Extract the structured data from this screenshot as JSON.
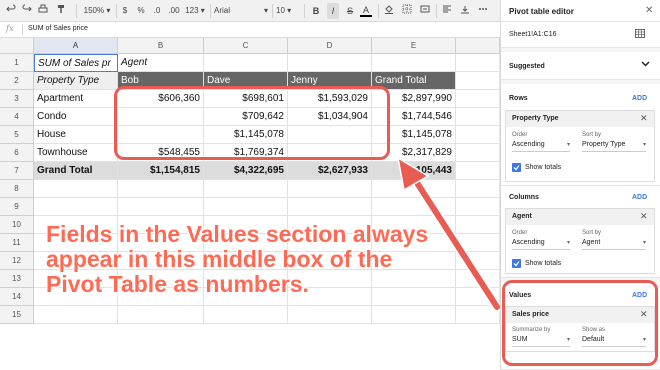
{
  "toolbar": {
    "zoom": "150%",
    "currency": "$",
    "percent": "%",
    "decimal_less": ".0",
    "decimal_more": ".00",
    "number_format": "123",
    "font_family": "Arial",
    "font_size": "10",
    "bold": "B",
    "italic": "I",
    "strike": "S",
    "text_color": "A"
  },
  "formula": {
    "fx": "fx",
    "content": "SUM of Sales price"
  },
  "grid": {
    "columns": [
      "A",
      "B",
      "C",
      "D",
      "E"
    ],
    "rows": [
      "1",
      "2",
      "3",
      "4",
      "5",
      "6",
      "7",
      "8",
      "9",
      "10",
      "11",
      "12",
      "13",
      "14",
      "15"
    ],
    "r1": {
      "a": "SUM of Sales pr",
      "b": "Agent"
    },
    "r2": {
      "a": "Property Type",
      "b": "Bob",
      "c": "Dave",
      "d": "Jenny",
      "e": "Grand Total"
    },
    "body": [
      {
        "a": "Apartment",
        "b": "$606,360",
        "c": "$698,601",
        "d": "$1,593,029",
        "e": "$2,897,990"
      },
      {
        "a": "Condo",
        "b": "",
        "c": "$709,642",
        "d": "$1,034,904",
        "e": "$1,744,546"
      },
      {
        "a": "House",
        "b": "",
        "c": "$1,145,078",
        "d": "",
        "e": "$1,145,078"
      },
      {
        "a": "Townhouse",
        "b": "$548,455",
        "c": "$1,769,374",
        "d": "",
        "e": "$2,317,829"
      }
    ],
    "total": {
      "a": "Grand Total",
      "b": "$1,154,815",
      "c": "$4,322,695",
      "d": "$2,627,933",
      "e": "$8,105,443"
    }
  },
  "annotation": "Fields in the Values section always appear in this middle box of the Pivot Table as numbers.",
  "panel": {
    "title": "Pivot table editor",
    "range": "Sheet1!A1:C16",
    "suggested": "Suggested",
    "rows": {
      "title": "Rows",
      "add": "ADD",
      "field": "Property Type",
      "order_label": "Order",
      "order_value": "Ascending",
      "sort_label": "Sort by",
      "sort_value": "Property Type",
      "totals": "Show totals"
    },
    "columns": {
      "title": "Columns",
      "add": "ADD",
      "field": "Agent",
      "order_label": "Order",
      "order_value": "Ascending",
      "sort_label": "Sort by",
      "sort_value": "Agent",
      "totals": "Show totals"
    },
    "values": {
      "title": "Values",
      "add": "ADD",
      "field": "Sales price",
      "summarize_label": "Summarize by",
      "summarize_value": "SUM",
      "show_label": "Show as",
      "show_value": "Default"
    }
  },
  "colors": {
    "accent": "#3b78e7",
    "annotation": "#e85c53",
    "header_dark": "#666666"
  }
}
